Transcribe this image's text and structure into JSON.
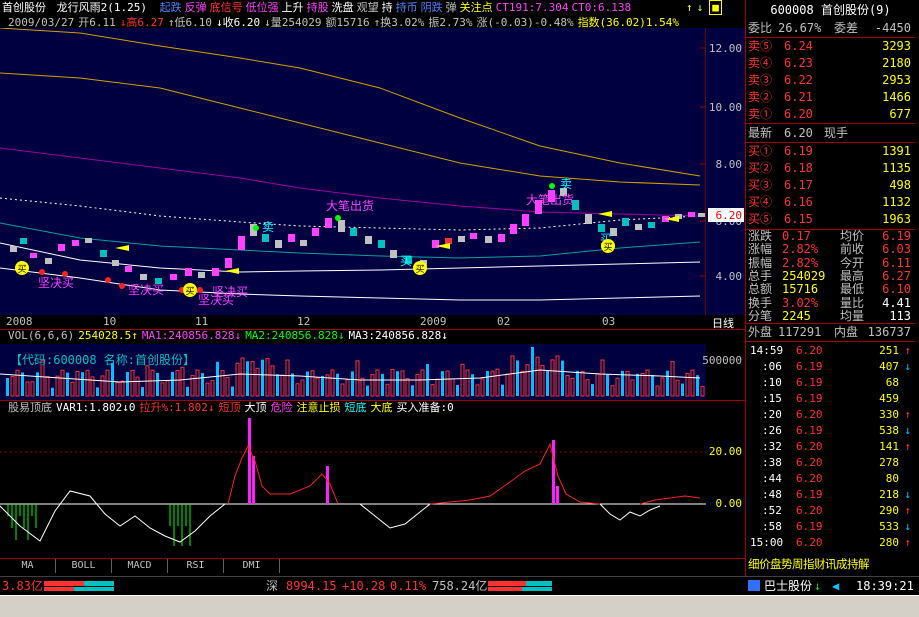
{
  "header": {
    "stock_name": "首创股份",
    "indicator": "龙行风雨2(1.25)",
    "signals": [
      {
        "text": "起跌",
        "color": "#5080ff"
      },
      {
        "text": "反弹",
        "color": "#ff40ff"
      },
      {
        "text": "底信号",
        "color": "#ff3232"
      },
      {
        "text": "低位强",
        "color": "#ff40ff"
      },
      {
        "text": "上升",
        "color": "#ffffff"
      },
      {
        "text": "持股",
        "color": "#ff40ff"
      },
      {
        "text": "洗盘",
        "color": "#ffffff"
      },
      {
        "text": "观望",
        "color": "#c0c0c0"
      },
      {
        "text": "持",
        "color": "#ffffff"
      },
      {
        "text": "持币",
        "color": "#5080ff"
      },
      {
        "text": "阴跌",
        "color": "#5080ff"
      },
      {
        "text": "弹",
        "color": "#c0c0c0"
      },
      {
        "text": "关注点",
        "color": "#ffff00"
      },
      {
        "text": "CT191:7.304",
        "color": "#ff40ff"
      },
      {
        "text": "CT0:6.138",
        "color": "#ff40ff"
      }
    ],
    "ohlc": [
      {
        "text": "2009/03/27",
        "color": "#c0c0c0"
      },
      {
        "text": "开6.11",
        "color": "#c0c0c0"
      },
      {
        "text": "↓高6.27",
        "color": "#ff3232"
      },
      {
        "text": "↑低6.10",
        "color": "#c0c0c0"
      },
      {
        "text": "↓收6.20",
        "color": "#ffffff"
      },
      {
        "text": "↓量254029",
        "color": "#c0c0c0"
      },
      {
        "text": "额15716",
        "color": "#c0c0c0"
      },
      {
        "text": "↑换3.02%",
        "color": "#c0c0c0"
      },
      {
        "text": "振2.73%",
        "color": "#c0c0c0"
      },
      {
        "text": "涨(-0.03)-0.48%",
        "color": "#c0c0c0"
      },
      {
        "text": "指数(36.02)1.54%",
        "color": "#ffff00"
      }
    ]
  },
  "main_chart": {
    "y_ticks": [
      "12.00",
      "10.00",
      "8.00",
      "6.00",
      "4.00"
    ],
    "current_price_tag": "6.20",
    "x_labels": [
      "2008",
      "10",
      "11",
      "12",
      "2009",
      "02",
      "03"
    ],
    "period_label": "日线",
    "annotations": [
      {
        "text": "大笔出货",
        "color": "#ff40ff"
      },
      {
        "text": "大笔出货",
        "color": "#ff40ff"
      },
      {
        "text": "坚决买",
        "color": "#ff40ff"
      },
      {
        "text": "坚决买",
        "color": "#ff40ff"
      },
      {
        "text": "坚决买",
        "color": "#ff40ff"
      },
      {
        "text": "坚决买",
        "color": "#ff40ff"
      },
      {
        "text": "卖",
        "color": "#00ffff"
      },
      {
        "text": "卖",
        "color": "#00ffff"
      },
      {
        "text": "买",
        "color": "#00ffff"
      },
      {
        "text": "买",
        "color": "#00ffff"
      }
    ],
    "badge_label": "买"
  },
  "volume": {
    "legend": [
      {
        "text": "VOL(6,6,6)",
        "color": "#c0c0c0"
      },
      {
        "text": "254028.5↑",
        "color": "#ffff00"
      },
      {
        "text": "MA1:240856.828↓",
        "color": "#ff40ff"
      },
      {
        "text": "MA2:240856.828↓",
        "color": "#00ff00"
      },
      {
        "text": "MA3:240856.828↓",
        "color": "#ffffff"
      }
    ],
    "banner": "【代码:600008 名称:首创股份】",
    "y_tick": "500000"
  },
  "indicator": {
    "legend": [
      {
        "text": "股易顶底",
        "color": "#c0c0c0"
      },
      {
        "text": "VAR1:1.802↓0",
        "color": "#ffffff"
      },
      {
        "text": "拉升%:1.802↓",
        "color": "#ff3232"
      },
      {
        "text": "短顶",
        "color": "#ff3232"
      },
      {
        "text": "大顶",
        "color": "#ffffff"
      },
      {
        "text": "危险",
        "color": "#ff40ff"
      },
      {
        "text": "注意止损",
        "color": "#ffff00"
      },
      {
        "text": "短底",
        "color": "#00ffff"
      },
      {
        "text": "大底",
        "color": "#ffff00"
      },
      {
        "text": "买入准备:0",
        "color": "#ffffff"
      }
    ],
    "y_ticks": [
      "20.00",
      "0.00"
    ]
  },
  "tabs": [
    "MA",
    "BOLL",
    "MACD",
    "RSI",
    "DMI"
  ],
  "quote": {
    "code": "600008",
    "name": "首创股份(9)",
    "weibi_label": "委比",
    "weibi": "26.67%",
    "weicha_label": "委差",
    "weicha": "-4450",
    "asks": [
      {
        "label": "卖⑤",
        "price": "6.24",
        "vol": "3293"
      },
      {
        "label": "卖④",
        "price": "6.23",
        "vol": "2180"
      },
      {
        "label": "卖③",
        "price": "6.22",
        "vol": "2953"
      },
      {
        "label": "卖②",
        "price": "6.21",
        "vol": "1466"
      },
      {
        "label": "卖①",
        "price": "6.20",
        "vol": "677"
      }
    ],
    "latest_label": "最新",
    "latest": "6.20",
    "xianshou_label": "现手",
    "bids": [
      {
        "label": "买①",
        "price": "6.19",
        "vol": "1391"
      },
      {
        "label": "买②",
        "price": "6.18",
        "vol": "1135"
      },
      {
        "label": "买③",
        "price": "6.17",
        "vol": "498"
      },
      {
        "label": "买④",
        "price": "6.16",
        "vol": "1132"
      },
      {
        "label": "买⑤",
        "price": "6.15",
        "vol": "1963"
      }
    ],
    "stats": [
      {
        "l1": "涨跌",
        "v1": "0.17",
        "l2": "均价",
        "v2": "6.19"
      },
      {
        "l1": "涨幅",
        "v1": "2.82%",
        "l2": "前收",
        "v2": "6.03"
      },
      {
        "l1": "振幅",
        "v1": "2.82%",
        "l2": "今开",
        "v2": "6.11"
      },
      {
        "l1": "总手",
        "v1": "254029",
        "l2": "最高",
        "v2": "6.27"
      },
      {
        "l1": "总额",
        "v1": "15716",
        "l2": "最低",
        "v2": "6.10"
      },
      {
        "l1": "换手",
        "v1": "3.02%",
        "l2": "量比",
        "v2": "4.41"
      },
      {
        "l1": "分笔",
        "v1": "2245",
        "l2": "均量",
        "v2": "113"
      }
    ],
    "outer_label": "外盘",
    "outer": "117291",
    "inner_label": "内盘",
    "inner": "136737"
  },
  "ticks": [
    {
      "time": "14:59",
      "price": "6.20",
      "vol": "251",
      "dir": "↑"
    },
    {
      "time": ":06",
      "price": "6.19",
      "vol": "407",
      "dir": "↓"
    },
    {
      "time": ":10",
      "price": "6.19",
      "vol": "68",
      "dir": ""
    },
    {
      "time": ":15",
      "price": "6.19",
      "vol": "459",
      "dir": ""
    },
    {
      "time": ":20",
      "price": "6.20",
      "vol": "330",
      "dir": "↑"
    },
    {
      "time": ":26",
      "price": "6.19",
      "vol": "538",
      "dir": "↓"
    },
    {
      "time": ":32",
      "price": "6.20",
      "vol": "141",
      "dir": "↑"
    },
    {
      "time": ":38",
      "price": "6.20",
      "vol": "278",
      "dir": ""
    },
    {
      "time": ":44",
      "price": "6.20",
      "vol": "80",
      "dir": ""
    },
    {
      "time": ":48",
      "price": "6.19",
      "vol": "218",
      "dir": "↓"
    },
    {
      "time": ":52",
      "price": "6.20",
      "vol": "290",
      "dir": "↑"
    },
    {
      "time": ":58",
      "price": "6.19",
      "vol": "533",
      "dir": "↓"
    },
    {
      "time": "15:00",
      "price": "6.20",
      "vol": "280",
      "dir": "↑"
    }
  ],
  "bottom_tabs": "细价盘势周指财讯成持解",
  "status_bar": {
    "left_value": "3.83亿",
    "index_name": "深",
    "index_value": "8994.15",
    "index_change": "+10.28",
    "index_pct": "0.11%",
    "index_amount": "758.24亿",
    "ticker": "巴士股份",
    "ticker_dir": "↓",
    "clock": "18:39:21"
  },
  "colors": {
    "up": "#ff3232",
    "down": "#00e600",
    "flat": "#c0c0c0",
    "frame": "#a00000"
  }
}
